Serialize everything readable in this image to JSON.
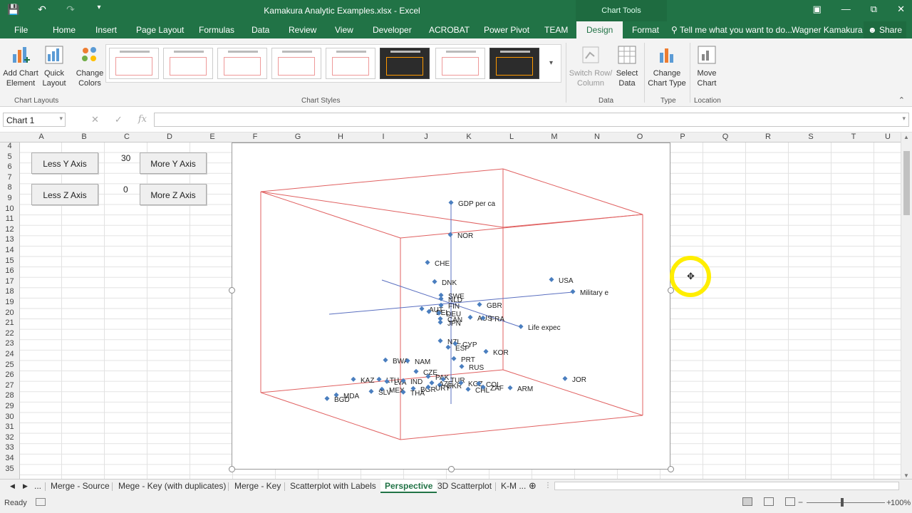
{
  "title_bar": {
    "document_title": "Kamakura Analytic Examples.xlsx - Excel",
    "context_label": "Chart Tools",
    "qat_icons": [
      "save-icon",
      "undo-icon",
      "redo-icon",
      "customize-icon"
    ],
    "window_controls": [
      "ribbon-display-icon",
      "minimize-icon",
      "restore-icon",
      "close-icon"
    ]
  },
  "ribbon_tabs": [
    "File",
    "Home",
    "Insert",
    "Page Layout",
    "Formulas",
    "Data",
    "Review",
    "View",
    "Developer",
    "ACROBAT",
    "Power Pivot",
    "TEAM",
    "Design",
    "Format"
  ],
  "active_ribbon_tab": "Design",
  "tell_me": "Tell me what you want to do...",
  "user_name": "Wagner Kamakura",
  "share_label": "Share",
  "ribbon": {
    "add_chart_element": "Add Chart Element",
    "quick_layout": "Quick Layout",
    "change_colors": "Change Colors",
    "switch_row_column": "Switch Row/ Column",
    "select_data": "Select Data",
    "change_chart_type": "Change Chart Type",
    "move_chart": "Move Chart",
    "groups": {
      "chart_layouts": "Chart Layouts",
      "chart_styles": "Chart Styles",
      "data": "Data",
      "type": "Type",
      "location": "Location"
    }
  },
  "formula_bar": {
    "name_box": "Chart 1",
    "fx": "fx",
    "cancel": "✕",
    "enter": "✓",
    "value": ""
  },
  "columns": [
    "A",
    "B",
    "C",
    "D",
    "E",
    "F",
    "G",
    "H",
    "I",
    "J",
    "K",
    "L",
    "M",
    "N",
    "O",
    "P",
    "Q",
    "R",
    "S",
    "T",
    "U"
  ],
  "rows": [
    "4",
    "5",
    "6",
    "7",
    "8",
    "9",
    "10",
    "11",
    "12",
    "13",
    "14",
    "15",
    "16",
    "17",
    "18",
    "19",
    "20",
    "21",
    "22",
    "23",
    "24",
    "25",
    "26",
    "27",
    "28",
    "29",
    "30",
    "31",
    "32",
    "33",
    "34",
    "35"
  ],
  "sheet_controls": {
    "less_y_axis": "Less Y Axis",
    "more_y_axis": "More Y Axis",
    "less_z_axis": "Less Z Axis",
    "more_z_axis": "More Z Axis",
    "y_value": "30",
    "z_value": "0"
  },
  "chart_data": {
    "type": "scatter",
    "axis_labels": [
      {
        "text": "GDP per ca"
      },
      {
        "text": "Military e"
      },
      {
        "text": "Life expec"
      }
    ],
    "series": [
      {
        "values": [
          [
            "NOR"
          ],
          [
            "CHE"
          ],
          [
            "DNK"
          ],
          [
            "USA"
          ],
          [
            "SWE"
          ],
          [
            "NLD"
          ],
          [
            "AUT"
          ],
          [
            "FIN"
          ],
          [
            "BEL"
          ],
          [
            "DEU"
          ],
          [
            "GBR"
          ],
          [
            "CAN"
          ],
          [
            "AUS"
          ],
          [
            "FRA"
          ],
          [
            "JPN"
          ],
          [
            "NZL"
          ],
          [
            "CYP"
          ],
          [
            "ESP"
          ],
          [
            "KOR"
          ],
          [
            "BWA"
          ],
          [
            "NAM"
          ],
          [
            "PRT"
          ],
          [
            "RUS"
          ],
          [
            "CZE"
          ],
          [
            "PAK"
          ],
          [
            "TUR"
          ],
          [
            "KAZ"
          ],
          [
            "LTU"
          ],
          [
            "LVA"
          ],
          [
            "IND"
          ],
          [
            "AZE"
          ],
          [
            "UKR"
          ],
          [
            "KGZ"
          ],
          [
            "COL"
          ],
          [
            "MEX"
          ],
          [
            "BGR"
          ],
          [
            "CHL"
          ],
          [
            "URY"
          ],
          [
            "ZAF"
          ],
          [
            "MDA"
          ],
          [
            "SLV"
          ],
          [
            "THA"
          ],
          [
            "BGD"
          ],
          [
            "ARM"
          ],
          [
            "JOR"
          ]
        ]
      }
    ],
    "colors": {
      "points": "#4a7ebf",
      "box": "#e06060",
      "axes": "#5a6fc0"
    }
  },
  "sheet_tabs": [
    "...",
    "Merge - Source",
    "Mege - Key (with duplicates)",
    "Merge - Key",
    "Scatterplot with Labels",
    "Perspective",
    "3D Scatterplot",
    "K-M ..."
  ],
  "active_sheet": "Perspective",
  "status": {
    "ready": "Ready",
    "zoom": "100%"
  }
}
